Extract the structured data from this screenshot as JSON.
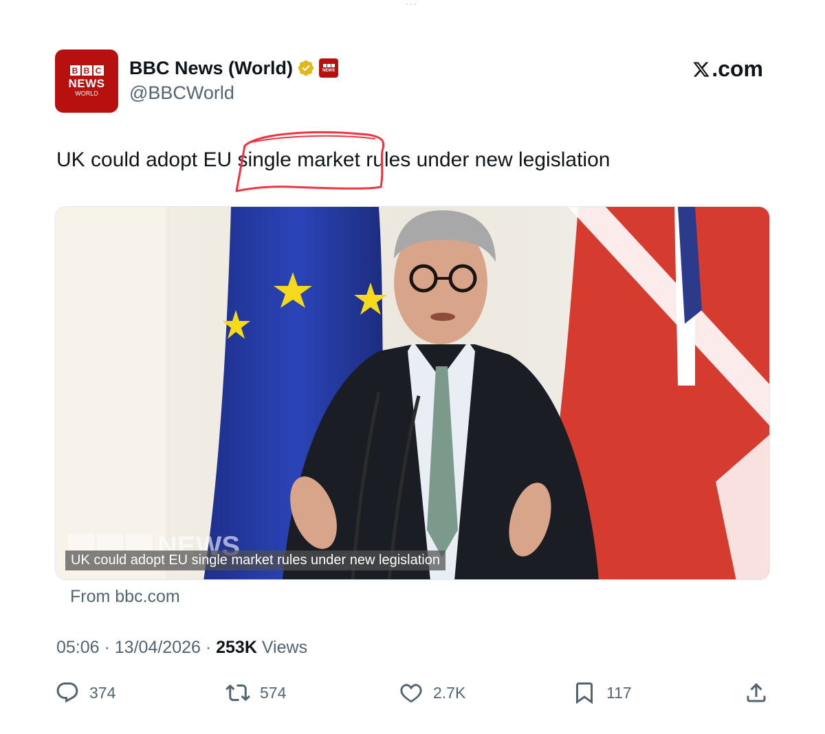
{
  "top_fragment": "...",
  "author": {
    "display_name": "BBC News (World)",
    "handle": "@BBCWorld",
    "avatar_news": "NEWS",
    "avatar_world": "WORLD",
    "avatar_letters": [
      "B",
      "B",
      "C"
    ],
    "affiliate_badge_text": "NEWS"
  },
  "site_label": ".com",
  "tweet": {
    "text_before": "UK could adopt EU ",
    "highlighted": "single market",
    "text_after": " rules under new legislation"
  },
  "card": {
    "caption": "UK could adopt EU single market rules under new legislation",
    "watermark_text": "NEWS",
    "source": "From bbc.com"
  },
  "meta": {
    "time": "05:06",
    "sep1": " · ",
    "date": "13/04/2026",
    "sep2": " · ",
    "views_count": "253K",
    "views_label": " Views"
  },
  "actions": {
    "replies": "374",
    "reposts": "574",
    "likes": "2.7K",
    "bookmarks": "117"
  },
  "colors": {
    "bbc_red": "#b80f0f",
    "highlight_circle": "#ef3340",
    "secondary_text": "#536471",
    "verified_gold": "#e2b719"
  }
}
